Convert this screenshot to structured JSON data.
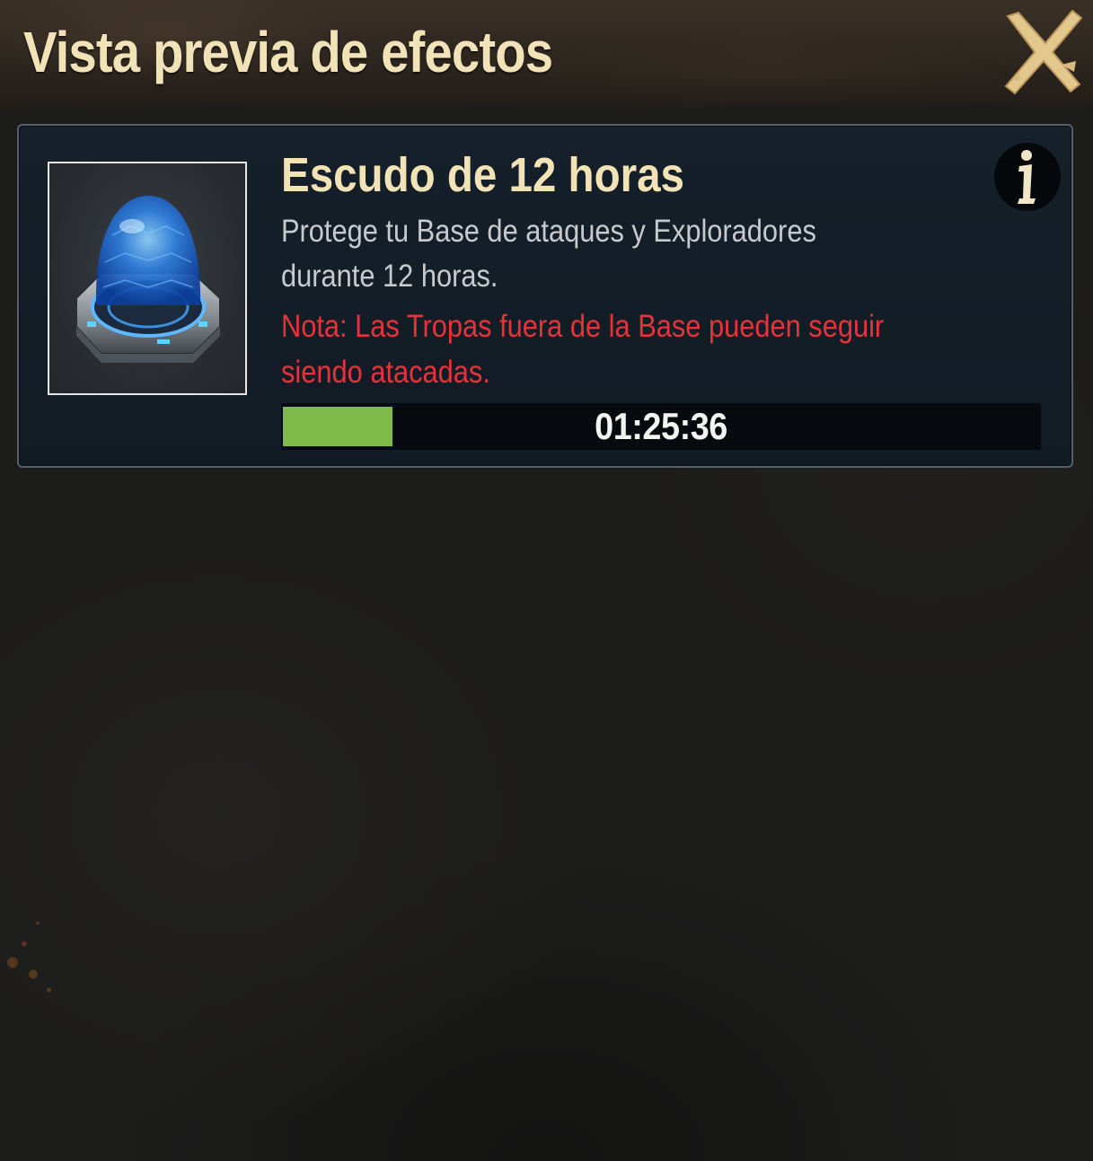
{
  "header": {
    "title": "Vista previa de efectos",
    "close_icon": "close-x-icon"
  },
  "effect": {
    "icon": "shield-dome-icon",
    "title": "Escudo de 12 horas",
    "description": "Protege tu Base de ataques y Exploradores durante 12 horas.",
    "note": "Nota: Las Tropas fuera de la Base pueden seguir siendo atacadas.",
    "info_icon": "info-icon",
    "timer": {
      "remaining": "01:25:36",
      "progress_percent": 14.5
    }
  },
  "colors": {
    "title_text": "#f1e2b8",
    "note_text": "#e8323a",
    "progress_fill": "#7fba4a",
    "card_background": "#15202a"
  }
}
